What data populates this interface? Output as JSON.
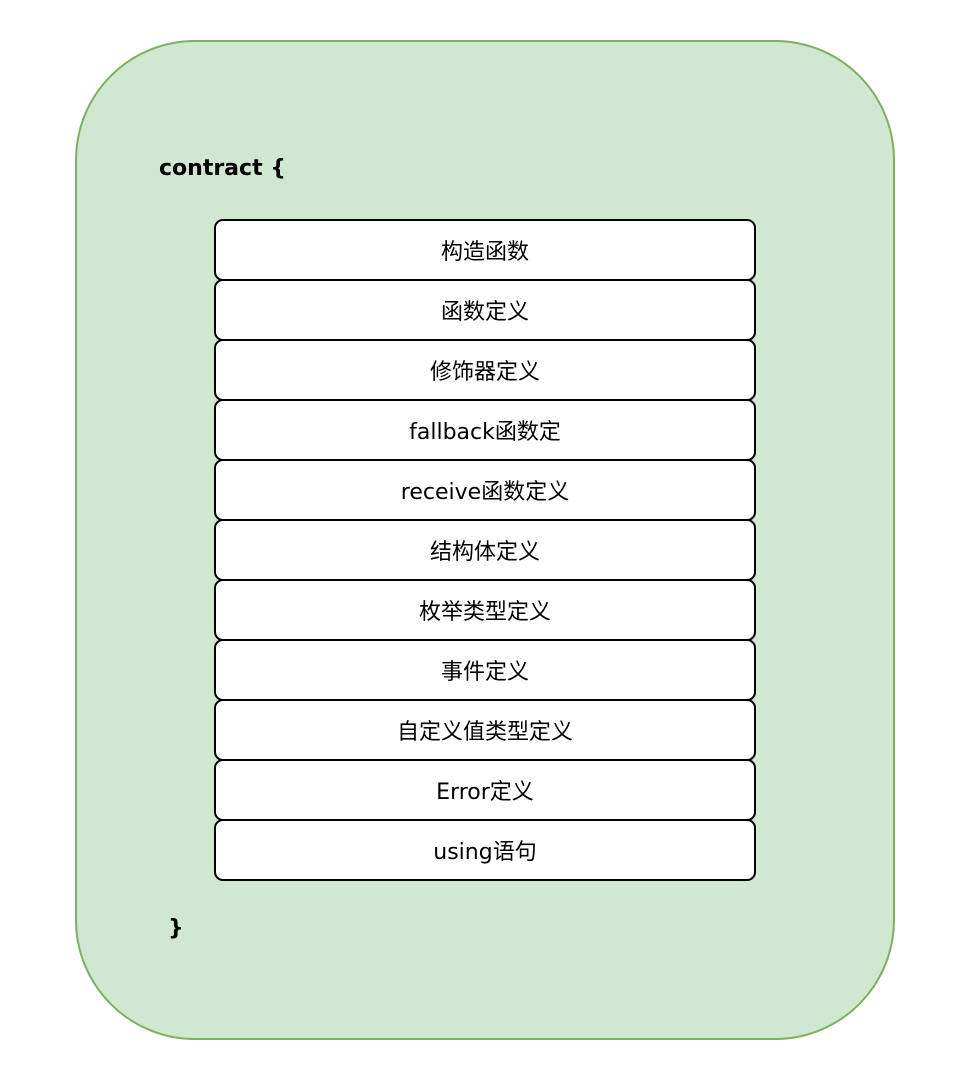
{
  "diagram": {
    "open_label": "contract {",
    "close_label": "}",
    "items": [
      "构造函数",
      "函数定义",
      "修饰器定义",
      "fallback函数定",
      "receive函数定义",
      "结构体定义",
      "枚举类型定义",
      "事件定义",
      "自定义值类型定义",
      "Error定义",
      "using语句"
    ]
  }
}
